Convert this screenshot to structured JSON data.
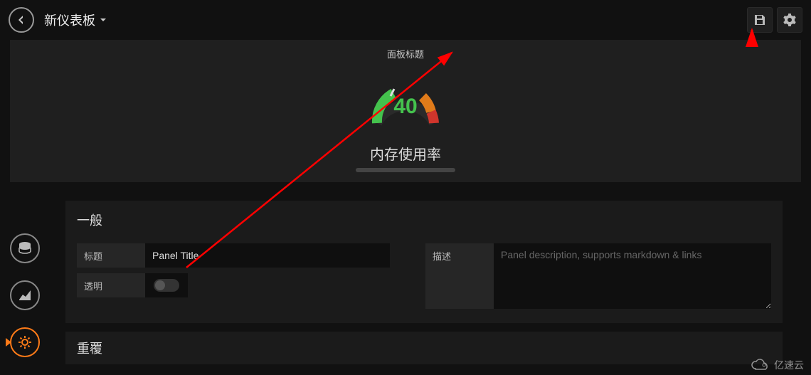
{
  "header": {
    "dashboard_title": "新仪表板"
  },
  "panel": {
    "title": "面板标题",
    "gauge": {
      "value": 40,
      "label": "内存使用率",
      "min": 0,
      "max": 100,
      "thresholds": [
        50,
        80
      ],
      "colors": {
        "ok": "#44c24d",
        "warn": "#e07b1a",
        "crit": "#d0352c"
      }
    }
  },
  "editor": {
    "sections": {
      "general": {
        "heading": "一般",
        "title_label": "标题",
        "title_value": "Panel Title",
        "transparent_label": "透明",
        "transparent_value": false,
        "description_label": "描述",
        "description_placeholder": "Panel description, supports markdown & links",
        "description_value": ""
      },
      "repeat": {
        "heading": "重覆"
      }
    },
    "side_tabs": [
      {
        "key": "queries",
        "semantic": "database-icon",
        "active": false
      },
      {
        "key": "visualization",
        "semantic": "chart-icon",
        "active": false
      },
      {
        "key": "general",
        "semantic": "gear-bug-icon",
        "active": true
      }
    ]
  },
  "icons": {
    "back": "back-arrow-icon",
    "dropdown": "caret-down-icon",
    "save": "save-icon",
    "settings": "gear-icon"
  },
  "watermark": "亿速云"
}
